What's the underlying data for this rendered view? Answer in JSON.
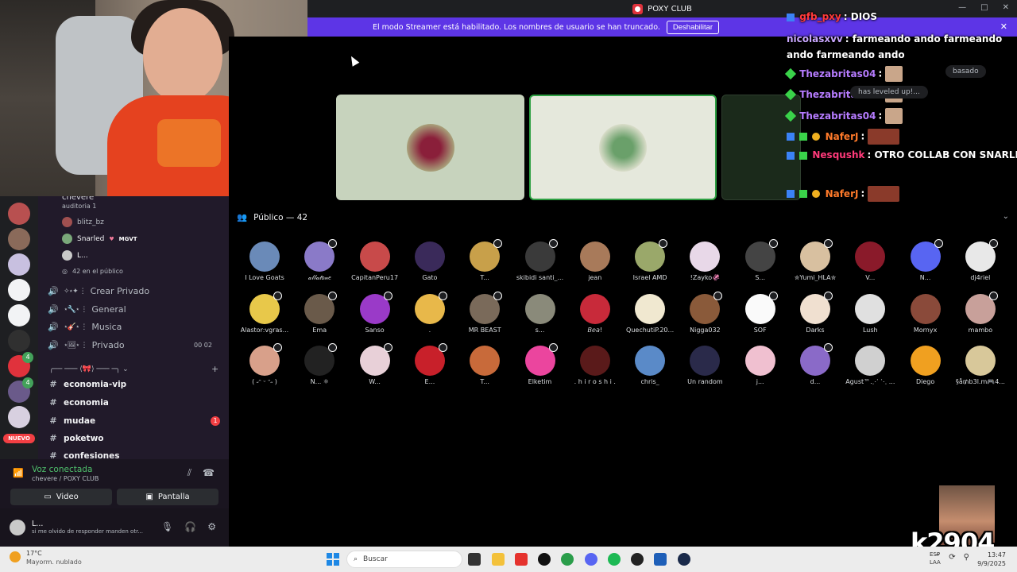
{
  "window": {
    "title": "POXY CLUB",
    "controls": [
      "—",
      "□",
      "✕"
    ]
  },
  "streamer_bar": {
    "text": "El modo Streamer está habilitado. Los nombres de usuario se han truncado.",
    "button": "Deshabilitar",
    "close": "✕"
  },
  "voice_channel": {
    "name": "chevere",
    "status": "auditoria 1",
    "members": [
      {
        "name": "blitz_bz",
        "tag": ""
      },
      {
        "name": "Snarled",
        "tag": "MGVT"
      },
      {
        "name": "L...",
        "tag": ""
      }
    ],
    "audience_note": "42 en el público"
  },
  "channels": [
    {
      "icon": "speaker",
      "deco": "✧⋆✦ ⋮",
      "label": "Crear Privado",
      "count": ""
    },
    {
      "icon": "speaker",
      "deco": "⋆🔧⋆ ⋮",
      "label": "General",
      "count": ""
    },
    {
      "icon": "speaker",
      "deco": "⋆🎸⋆ ⋮",
      "label": "Musica",
      "count": ""
    },
    {
      "icon": "speaker",
      "deco": "⋆🖼⋆ ⋮",
      "label": "Privado",
      "count": "00 02"
    }
  ],
  "category": "╭── ─── ⟨🎀⟩ ─── ─╮ ⌄",
  "text_channels": [
    {
      "label": "economia-vip",
      "unread": ""
    },
    {
      "label": "economia",
      "unread": ""
    },
    {
      "label": "mudae",
      "unread": "1"
    },
    {
      "label": "poketwo",
      "unread": ""
    },
    {
      "label": "confesiones",
      "unread": ""
    }
  ],
  "rail": {
    "nuevo": "NUEVO",
    "badges": [
      "4",
      "4"
    ]
  },
  "voice_panel": {
    "title": "Voz conectada",
    "sub": "chevere / POXY CLUB",
    "video": "Video",
    "screen": "Pantalla"
  },
  "user": {
    "name": "L...",
    "status": "si me olvido de responder manden otr..."
  },
  "stage": {
    "audience_title": "Público — 42",
    "audience": [
      "I Love Goats",
      "𝒶𝓁𝓁𝒶𝓉𝑜𝓃𝑒",
      "CapitanPeru17",
      "Gato",
      "T...",
      "skibidi santi_...",
      "jean",
      "Israel AMD",
      "!Zayko🦑",
      "S...",
      "✮Yumi_HLA✮",
      "V...",
      "N...",
      "dj4riel",
      "Alastor:vgras...",
      "Ema",
      "Sanso",
      ".",
      "MR BEAST",
      "s...",
      "𝘉𝘦𝘢!",
      "QuechutiP.20...",
      "Nigga032",
      "SOF",
      "Darks",
      "Lush",
      "Mornyx",
      "mambo",
      "( ˶ᵔ ᵕ ᵔ˶ )",
      "N... ⚛",
      "W...",
      "E...",
      "T...",
      "Elketim",
      ". h i r o s h i .",
      "chris_",
      "Un random",
      "j...",
      "d...",
      "Agust™.⋰ ⋱ ...",
      "Diego",
      "§å₥b3l.m🎮4..."
    ]
  },
  "chat": [
    {
      "user": "gfb_pxy",
      "text": "DIOS",
      "color": "#ff3a3a"
    },
    {
      "user": "nicolasxvv",
      "text": "farmeando ando farmeando ando farmeando ando",
      "color": "#c9a7ff"
    },
    {
      "user": "Thezabritas04",
      "text": "",
      "color": "#b67cff"
    },
    {
      "user": "Thezabritas04",
      "text": "",
      "color": "#b67cff"
    },
    {
      "user": "Thezabritas04",
      "text": "",
      "color": "#b67cff"
    },
    {
      "user": "NaferJ",
      "text": "",
      "color": "#ff7a2a"
    },
    {
      "user": "Nesqushk",
      "text": "OTRO COLLAB CON SNARLED",
      "color": "#ff3a7a"
    },
    {
      "user": "NaferJ",
      "text": "",
      "color": "#ff7a2a"
    }
  ],
  "chat_notices": {
    "basado": "basado",
    "levelup": "has leveled up!..."
  },
  "overlay": {
    "watermark": "k2904"
  },
  "taskbar": {
    "weather_temp": "17°C",
    "weather_cond": "Mayorm. nublado",
    "search": "Buscar",
    "lang": "ESP\nLAA",
    "time": "13:47",
    "date": "9/9/2025"
  }
}
